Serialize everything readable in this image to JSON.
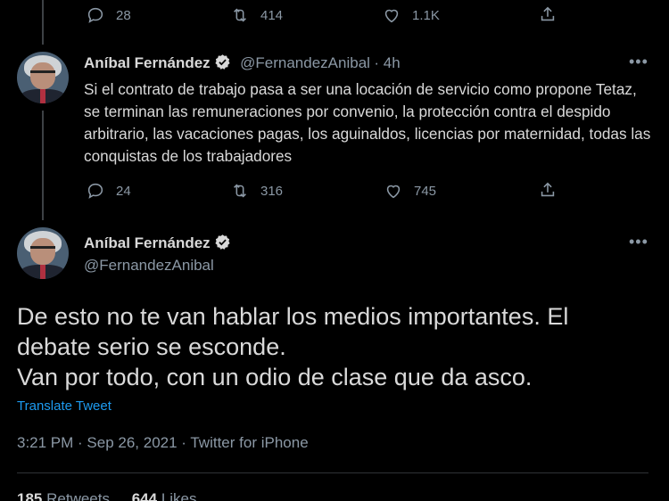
{
  "prev_tweet": {
    "reply_count": "28",
    "retweet_count": "414",
    "like_count": "1.1K"
  },
  "reply_tweet": {
    "author_name": "Aníbal Fernández",
    "handle": "@FernandezAnibal",
    "time": "· 4h",
    "more": "•••",
    "text": "Si el contrato de trabajo pasa a ser una locación de servicio como propone Tetaz, se terminan las remuneraciones por convenio, la protección contra el despido arbitrario, las vacaciones pagas, los aguinaldos, licencias por maternidad, todas las conquistas de los trabajadores",
    "reply_count": "24",
    "retweet_count": "316",
    "like_count": "745"
  },
  "main_tweet": {
    "author_name": "Aníbal Fernández",
    "handle": "@FernandezAnibal",
    "more": "•••",
    "text_line1": "De esto no te van hablar los medios importantes. El",
    "text_line2": "debate serio se esconde.",
    "text_line3": "Van por todo, con un odio de clase que da asco.",
    "translate_label": "Translate Tweet",
    "meta": "3:21 PM · Sep 26, 2021 · Twitter for iPhone",
    "retweets_count": "185",
    "retweets_label": "Retweets",
    "likes_count": "644",
    "likes_label": "Likes"
  },
  "colors": {
    "background": "#000000",
    "text": "#d9d9d9",
    "muted": "#8b98a5",
    "link": "#1d9bf0"
  }
}
